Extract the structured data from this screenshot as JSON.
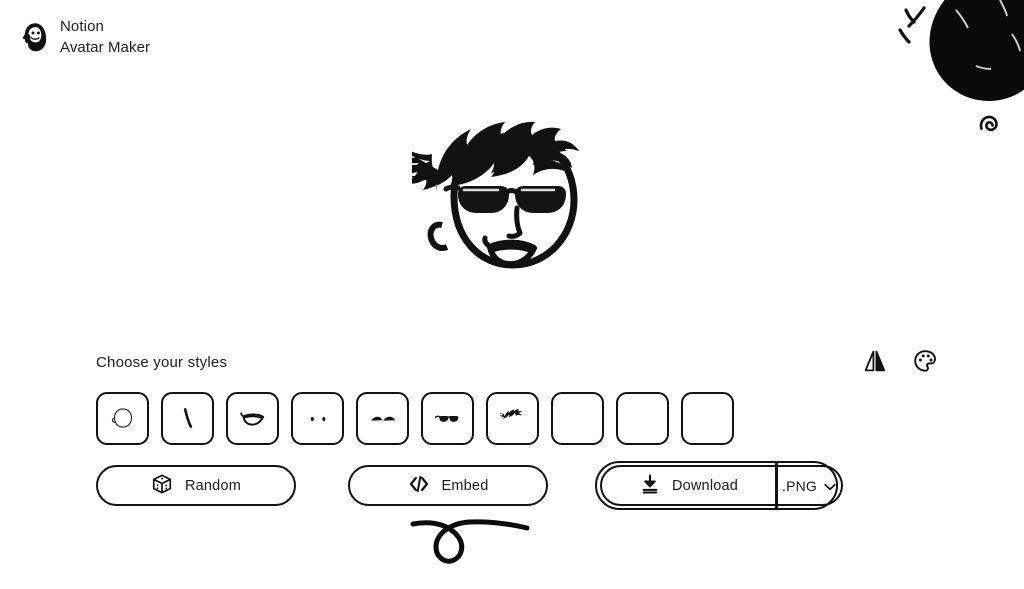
{
  "app": {
    "brand_line1": "Notion",
    "brand_line2": "Avatar Maker",
    "logo_icon": "avatar-face-icon",
    "background_color": "#ffffff",
    "ink_color": "#121212"
  },
  "decorations": [
    {
      "name": "blob-decoration",
      "icon": "filled-blob-icon"
    },
    {
      "name": "tick-marks-decoration",
      "icon": "three-strokes-icon"
    },
    {
      "name": "spiral-decoration",
      "icon": "spiral-icon"
    },
    {
      "name": "squiggle-decoration",
      "icon": "looped-squiggle-icon"
    }
  ],
  "preview": {
    "name": "avatar-preview",
    "description": "Cartoon avatar with spiky black hair, aviator sunglasses and open smile",
    "features": [
      "hair",
      "sunglasses",
      "face",
      "ear",
      "nose",
      "mouth"
    ]
  },
  "panel": {
    "title": "Choose your styles",
    "tools": [
      {
        "label": "",
        "icon": "flip-icon",
        "name": "flip-button"
      },
      {
        "label": "",
        "icon": "palette-icon",
        "name": "palette-button"
      }
    ],
    "style_cells": [
      {
        "name": "style-cell-face",
        "icon": "face-shape-icon",
        "filled": false
      },
      {
        "name": "style-cell-nose",
        "icon": "nose-icon",
        "filled": false
      },
      {
        "name": "style-cell-mouth",
        "icon": "mouth-icon",
        "filled": false
      },
      {
        "name": "style-cell-eyes",
        "icon": "eyes-icon",
        "filled": false
      },
      {
        "name": "style-cell-eyebrows",
        "icon": "eyebrows-icon",
        "filled": false
      },
      {
        "name": "style-cell-glasses",
        "icon": "glasses-icon",
        "filled": false
      },
      {
        "name": "style-cell-hair",
        "icon": "hair-icon",
        "filled": true
      },
      {
        "name": "style-cell-empty-1",
        "icon": "empty-icon",
        "filled": false
      },
      {
        "name": "style-cell-empty-2",
        "icon": "empty-icon",
        "filled": false
      },
      {
        "name": "style-cell-empty-3",
        "icon": "empty-icon",
        "filled": false
      }
    ]
  },
  "actions": {
    "random": {
      "label": "Random",
      "icon": "dice-icon"
    },
    "embed": {
      "label": "Embed",
      "icon": "code-icon"
    },
    "download": {
      "label": "Download",
      "icon": "download-icon",
      "focused": true
    },
    "format": {
      "label": ".PNG",
      "icon": "chevron-down-icon"
    }
  }
}
